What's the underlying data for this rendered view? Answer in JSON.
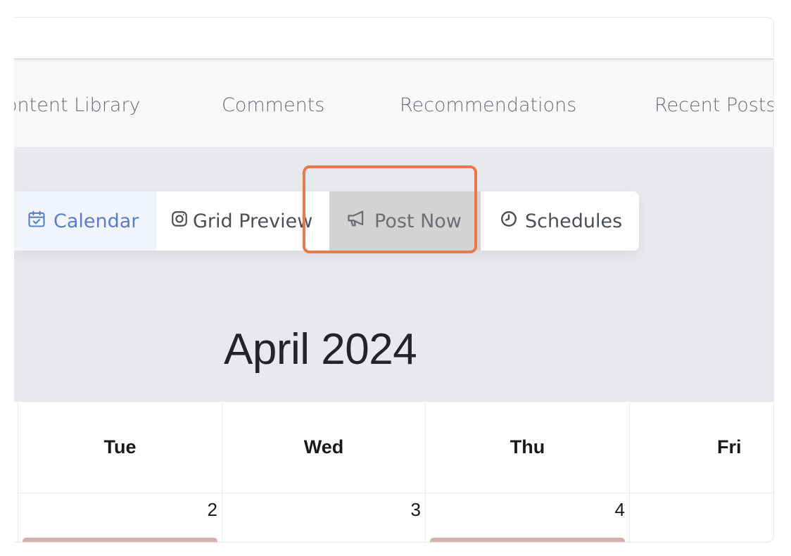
{
  "nav_tabs": [
    {
      "label": "ontent Library"
    },
    {
      "label": "Comments"
    },
    {
      "label": "Recommendations"
    },
    {
      "label": "Recent Posts"
    }
  ],
  "view_toolbar": {
    "calendar_label": "Calendar",
    "grid_preview_label": "Grid Preview",
    "post_now_label": "Post Now",
    "schedules_label": "Schedules"
  },
  "calendar": {
    "month_title": "April 2024",
    "columns": [
      {
        "weekday": "Tue",
        "day": "2",
        "has_event": true
      },
      {
        "weekday": "Wed",
        "day": "3",
        "has_event": false
      },
      {
        "weekday": "Thu",
        "day": "4",
        "has_event": true
      },
      {
        "weekday": "Fri",
        "day": "",
        "has_event": false
      }
    ]
  },
  "colors": {
    "accent_blue": "#5b7fc4",
    "highlight_orange": "#e8794d",
    "selected_grey": "#d3d3d3",
    "event_pink": "#d4b1ac"
  },
  "icons": {
    "calendar": "calendar-check-icon",
    "grid_preview": "instagram-icon",
    "post_now": "megaphone-icon",
    "schedules": "clock-icon"
  }
}
